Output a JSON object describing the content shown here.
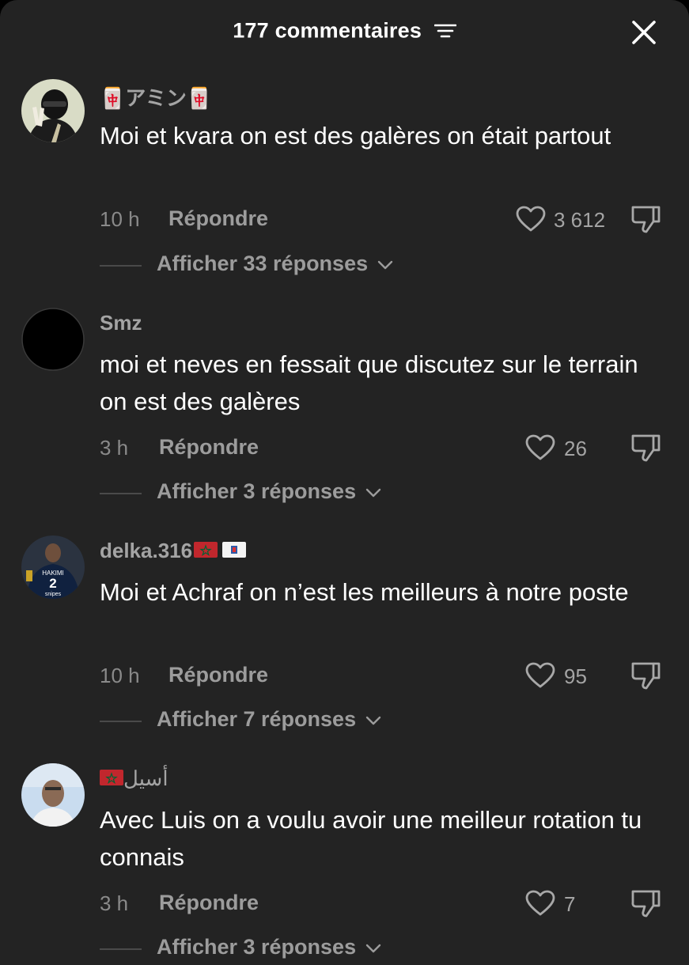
{
  "header": {
    "title": "177 commentaires"
  },
  "comments": [
    {
      "username": "🀄アミン🀄",
      "text": "Moi et kvara on est des galères on était partout",
      "time": "10 h",
      "reply_label": "Répondre",
      "likes": "3 612",
      "replies_label": "Afficher 33 réponses"
    },
    {
      "username": "Smz",
      "text": "moi et neves en fessait que discutez sur le terrain on est des galères",
      "time": "3 h",
      "reply_label": "Répondre",
      "likes": "26",
      "replies_label": "Afficher 3 réponses"
    },
    {
      "username": "delka.316",
      "text": "Moi et Achraf on n’est les meilleurs à notre poste",
      "time": "10 h",
      "reply_label": "Répondre",
      "likes": "95",
      "replies_label": "Afficher 7 réponses"
    },
    {
      "username": "أسيل",
      "text": "Avec Luis on a voulu avoir une meilleur rotation tu connais",
      "time": "3 h",
      "reply_label": "Répondre",
      "likes": "7",
      "replies_label": "Afficher 3 réponses"
    }
  ],
  "colors": {
    "background": "#232323",
    "text": "#ffffff",
    "muted": "#9c9c9c",
    "flag_red": "#c1272d",
    "flag_green": "#006233"
  },
  "icons": [
    "filter-icon",
    "close-icon",
    "heart-icon",
    "thumbs-down-icon",
    "chevron-down-icon",
    "flag-morocco-icon"
  ]
}
